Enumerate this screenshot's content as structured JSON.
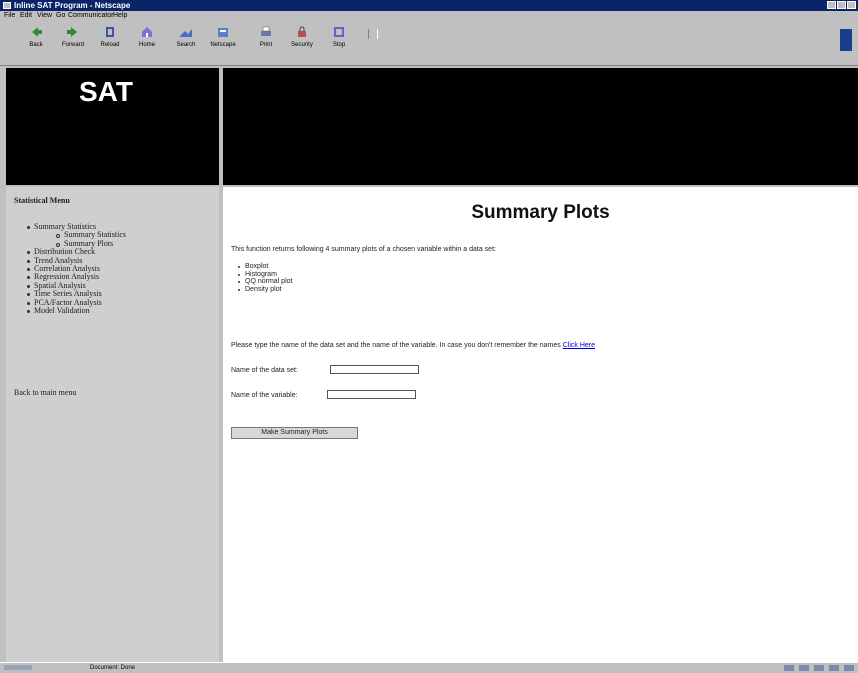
{
  "window": {
    "title": "Inline SAT Program - Netscape"
  },
  "menubar": [
    "File",
    "Edit",
    "View",
    "Go",
    "Communicator",
    "Help"
  ],
  "toolbar": [
    {
      "label": "Back",
      "icon": "back-arrow-icon",
      "color": "#2e8b2e"
    },
    {
      "label": "Forward",
      "icon": "forward-arrow-icon",
      "color": "#2e8b2e"
    },
    {
      "label": "Reload",
      "icon": "reload-icon",
      "color": "#3a4fb0"
    },
    {
      "label": "Home",
      "icon": "home-icon",
      "color": "#7b6fd8"
    },
    {
      "label": "Search",
      "icon": "search-icon",
      "color": "#4b6cc8"
    },
    {
      "label": "Netscape",
      "icon": "netscape-icon",
      "color": "#5a7fc4"
    },
    {
      "label": "Print",
      "icon": "print-icon",
      "color": "#6b7ba8"
    },
    {
      "label": "Security",
      "icon": "lock-icon",
      "color": "#b2504e"
    },
    {
      "label": "Stop",
      "icon": "stop-icon",
      "color": "#5b5fd8"
    }
  ],
  "banner": {
    "title": "SAT"
  },
  "sidebar": {
    "heading": "Statistical Menu",
    "items": [
      {
        "label": "Summary Statistics",
        "level": 0
      },
      {
        "label": "Summary Statistics",
        "level": 1
      },
      {
        "label": "Summary Plots",
        "level": 1
      },
      {
        "label": "Distribution Check",
        "level": 0
      },
      {
        "label": "Trend Analysis",
        "level": 0
      },
      {
        "label": "Correlation Analysis",
        "level": 0
      },
      {
        "label": "Regression Analysis",
        "level": 0
      },
      {
        "label": "Spatial Analysis",
        "level": 0
      },
      {
        "label": "Time Series Analysis",
        "level": 0
      },
      {
        "label": "PCA/Factor Analysis",
        "level": 0
      },
      {
        "label": "Model Validation",
        "level": 0
      }
    ],
    "back_link": "Back to main menu"
  },
  "main": {
    "title": "Summary Plots",
    "intro": "This function returns following 4 summary plots of a chosen variable within a data set:",
    "plots": [
      "Boxplot",
      "Histogram",
      "QQ normal plot",
      "Density plot"
    ],
    "instruction": "Please type the name of the data set and the name of the variable. In case you don't remember the names",
    "instruction_link": "Click Here",
    "dataset_label": "Name of the data set:",
    "dataset_value": "",
    "variable_label": "Name of the variable:",
    "variable_value": "",
    "submit_label": "Make Summary Plots"
  },
  "statusbar": {
    "text": "Document: Done"
  }
}
